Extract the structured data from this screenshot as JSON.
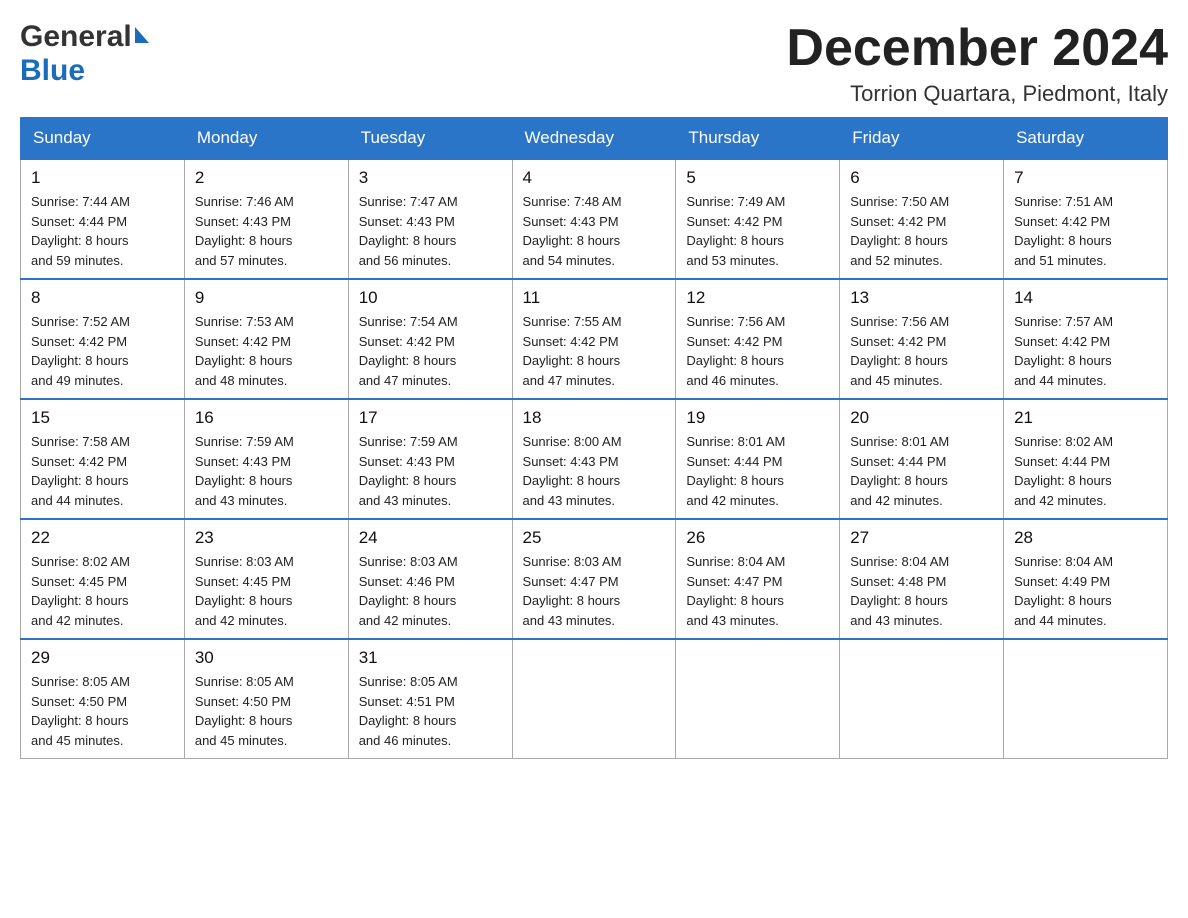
{
  "header": {
    "logo_general": "General",
    "logo_blue": "Blue",
    "month_title": "December 2024",
    "location": "Torrion Quartara, Piedmont, Italy"
  },
  "days_of_week": [
    "Sunday",
    "Monday",
    "Tuesday",
    "Wednesday",
    "Thursday",
    "Friday",
    "Saturday"
  ],
  "weeks": [
    [
      {
        "day": "1",
        "sunrise": "Sunrise: 7:44 AM",
        "sunset": "Sunset: 4:44 PM",
        "daylight": "Daylight: 8 hours",
        "daylight2": "and 59 minutes."
      },
      {
        "day": "2",
        "sunrise": "Sunrise: 7:46 AM",
        "sunset": "Sunset: 4:43 PM",
        "daylight": "Daylight: 8 hours",
        "daylight2": "and 57 minutes."
      },
      {
        "day": "3",
        "sunrise": "Sunrise: 7:47 AM",
        "sunset": "Sunset: 4:43 PM",
        "daylight": "Daylight: 8 hours",
        "daylight2": "and 56 minutes."
      },
      {
        "day": "4",
        "sunrise": "Sunrise: 7:48 AM",
        "sunset": "Sunset: 4:43 PM",
        "daylight": "Daylight: 8 hours",
        "daylight2": "and 54 minutes."
      },
      {
        "day": "5",
        "sunrise": "Sunrise: 7:49 AM",
        "sunset": "Sunset: 4:42 PM",
        "daylight": "Daylight: 8 hours",
        "daylight2": "and 53 minutes."
      },
      {
        "day": "6",
        "sunrise": "Sunrise: 7:50 AM",
        "sunset": "Sunset: 4:42 PM",
        "daylight": "Daylight: 8 hours",
        "daylight2": "and 52 minutes."
      },
      {
        "day": "7",
        "sunrise": "Sunrise: 7:51 AM",
        "sunset": "Sunset: 4:42 PM",
        "daylight": "Daylight: 8 hours",
        "daylight2": "and 51 minutes."
      }
    ],
    [
      {
        "day": "8",
        "sunrise": "Sunrise: 7:52 AM",
        "sunset": "Sunset: 4:42 PM",
        "daylight": "Daylight: 8 hours",
        "daylight2": "and 49 minutes."
      },
      {
        "day": "9",
        "sunrise": "Sunrise: 7:53 AM",
        "sunset": "Sunset: 4:42 PM",
        "daylight": "Daylight: 8 hours",
        "daylight2": "and 48 minutes."
      },
      {
        "day": "10",
        "sunrise": "Sunrise: 7:54 AM",
        "sunset": "Sunset: 4:42 PM",
        "daylight": "Daylight: 8 hours",
        "daylight2": "and 47 minutes."
      },
      {
        "day": "11",
        "sunrise": "Sunrise: 7:55 AM",
        "sunset": "Sunset: 4:42 PM",
        "daylight": "Daylight: 8 hours",
        "daylight2": "and 47 minutes."
      },
      {
        "day": "12",
        "sunrise": "Sunrise: 7:56 AM",
        "sunset": "Sunset: 4:42 PM",
        "daylight": "Daylight: 8 hours",
        "daylight2": "and 46 minutes."
      },
      {
        "day": "13",
        "sunrise": "Sunrise: 7:56 AM",
        "sunset": "Sunset: 4:42 PM",
        "daylight": "Daylight: 8 hours",
        "daylight2": "and 45 minutes."
      },
      {
        "day": "14",
        "sunrise": "Sunrise: 7:57 AM",
        "sunset": "Sunset: 4:42 PM",
        "daylight": "Daylight: 8 hours",
        "daylight2": "and 44 minutes."
      }
    ],
    [
      {
        "day": "15",
        "sunrise": "Sunrise: 7:58 AM",
        "sunset": "Sunset: 4:42 PM",
        "daylight": "Daylight: 8 hours",
        "daylight2": "and 44 minutes."
      },
      {
        "day": "16",
        "sunrise": "Sunrise: 7:59 AM",
        "sunset": "Sunset: 4:43 PM",
        "daylight": "Daylight: 8 hours",
        "daylight2": "and 43 minutes."
      },
      {
        "day": "17",
        "sunrise": "Sunrise: 7:59 AM",
        "sunset": "Sunset: 4:43 PM",
        "daylight": "Daylight: 8 hours",
        "daylight2": "and 43 minutes."
      },
      {
        "day": "18",
        "sunrise": "Sunrise: 8:00 AM",
        "sunset": "Sunset: 4:43 PM",
        "daylight": "Daylight: 8 hours",
        "daylight2": "and 43 minutes."
      },
      {
        "day": "19",
        "sunrise": "Sunrise: 8:01 AM",
        "sunset": "Sunset: 4:44 PM",
        "daylight": "Daylight: 8 hours",
        "daylight2": "and 42 minutes."
      },
      {
        "day": "20",
        "sunrise": "Sunrise: 8:01 AM",
        "sunset": "Sunset: 4:44 PM",
        "daylight": "Daylight: 8 hours",
        "daylight2": "and 42 minutes."
      },
      {
        "day": "21",
        "sunrise": "Sunrise: 8:02 AM",
        "sunset": "Sunset: 4:44 PM",
        "daylight": "Daylight: 8 hours",
        "daylight2": "and 42 minutes."
      }
    ],
    [
      {
        "day": "22",
        "sunrise": "Sunrise: 8:02 AM",
        "sunset": "Sunset: 4:45 PM",
        "daylight": "Daylight: 8 hours",
        "daylight2": "and 42 minutes."
      },
      {
        "day": "23",
        "sunrise": "Sunrise: 8:03 AM",
        "sunset": "Sunset: 4:45 PM",
        "daylight": "Daylight: 8 hours",
        "daylight2": "and 42 minutes."
      },
      {
        "day": "24",
        "sunrise": "Sunrise: 8:03 AM",
        "sunset": "Sunset: 4:46 PM",
        "daylight": "Daylight: 8 hours",
        "daylight2": "and 42 minutes."
      },
      {
        "day": "25",
        "sunrise": "Sunrise: 8:03 AM",
        "sunset": "Sunset: 4:47 PM",
        "daylight": "Daylight: 8 hours",
        "daylight2": "and 43 minutes."
      },
      {
        "day": "26",
        "sunrise": "Sunrise: 8:04 AM",
        "sunset": "Sunset: 4:47 PM",
        "daylight": "Daylight: 8 hours",
        "daylight2": "and 43 minutes."
      },
      {
        "day": "27",
        "sunrise": "Sunrise: 8:04 AM",
        "sunset": "Sunset: 4:48 PM",
        "daylight": "Daylight: 8 hours",
        "daylight2": "and 43 minutes."
      },
      {
        "day": "28",
        "sunrise": "Sunrise: 8:04 AM",
        "sunset": "Sunset: 4:49 PM",
        "daylight": "Daylight: 8 hours",
        "daylight2": "and 44 minutes."
      }
    ],
    [
      {
        "day": "29",
        "sunrise": "Sunrise: 8:05 AM",
        "sunset": "Sunset: 4:50 PM",
        "daylight": "Daylight: 8 hours",
        "daylight2": "and 45 minutes."
      },
      {
        "day": "30",
        "sunrise": "Sunrise: 8:05 AM",
        "sunset": "Sunset: 4:50 PM",
        "daylight": "Daylight: 8 hours",
        "daylight2": "and 45 minutes."
      },
      {
        "day": "31",
        "sunrise": "Sunrise: 8:05 AM",
        "sunset": "Sunset: 4:51 PM",
        "daylight": "Daylight: 8 hours",
        "daylight2": "and 46 minutes."
      },
      null,
      null,
      null,
      null
    ]
  ]
}
